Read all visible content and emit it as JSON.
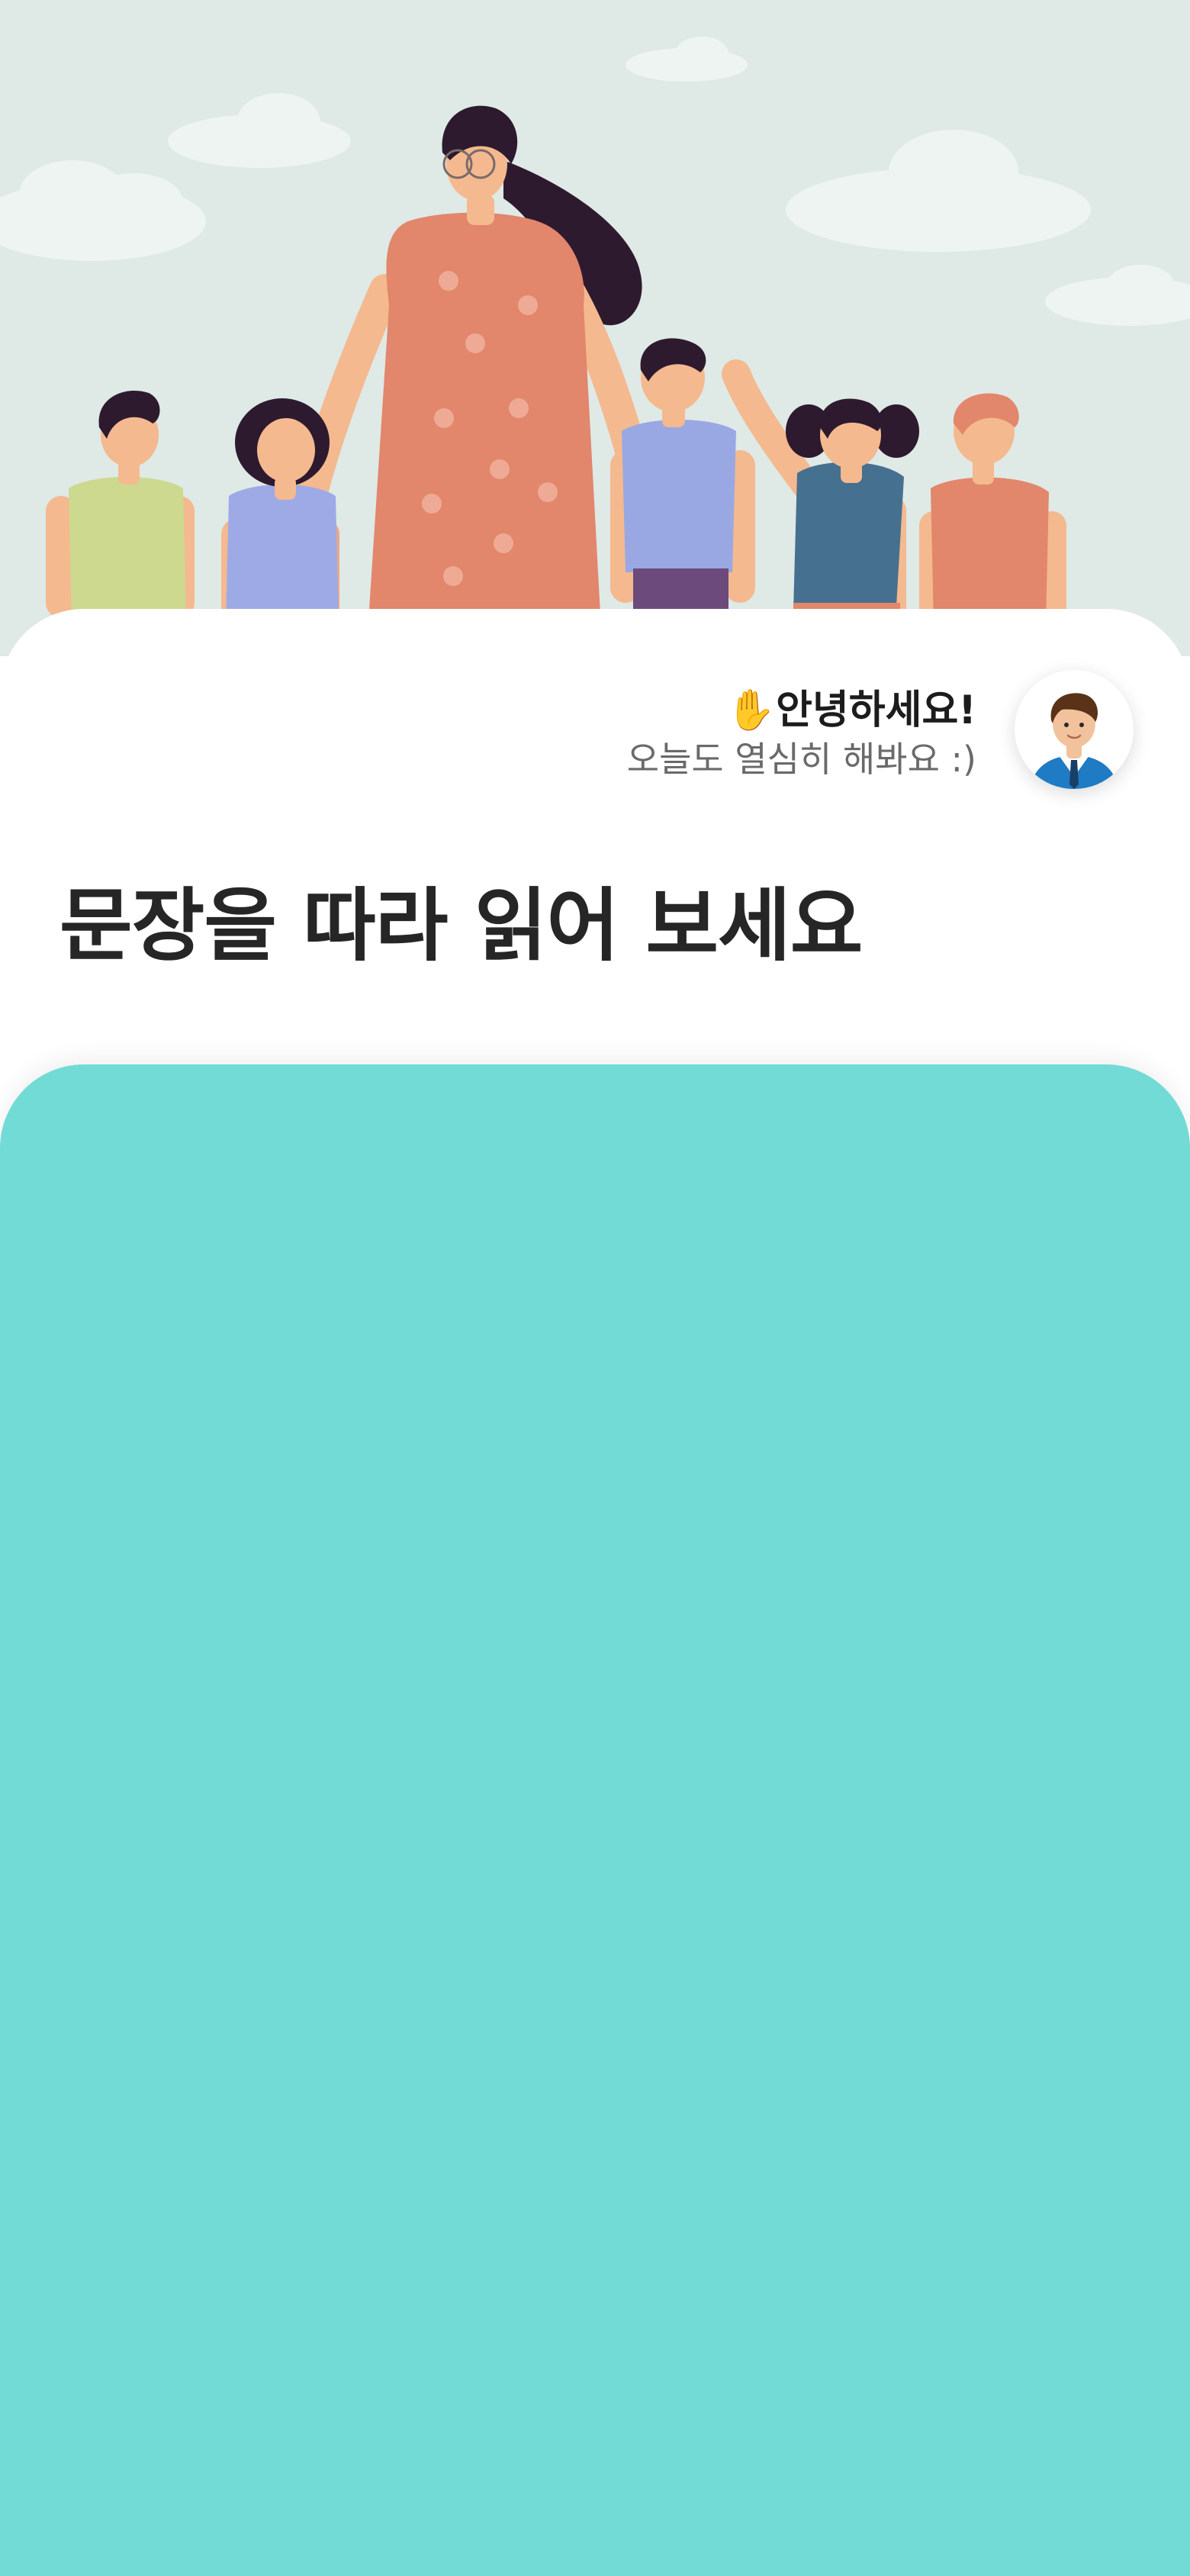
{
  "greeting": {
    "wave_emoji": "✋",
    "title": "안녕하세요!",
    "subtitle": "오늘도 열심히 해봐요 :)"
  },
  "main": {
    "title": "문장을 따라 읽어 보세요"
  },
  "colors": {
    "hero_background": "#dfe9e6",
    "panel_teal": "#72dbd5",
    "title_text": "#262626",
    "subtitle_text": "#6a6a6a"
  },
  "icons": {
    "avatar": "teacher-avatar-icon",
    "illustration": "teacher-and-children-illustration"
  }
}
